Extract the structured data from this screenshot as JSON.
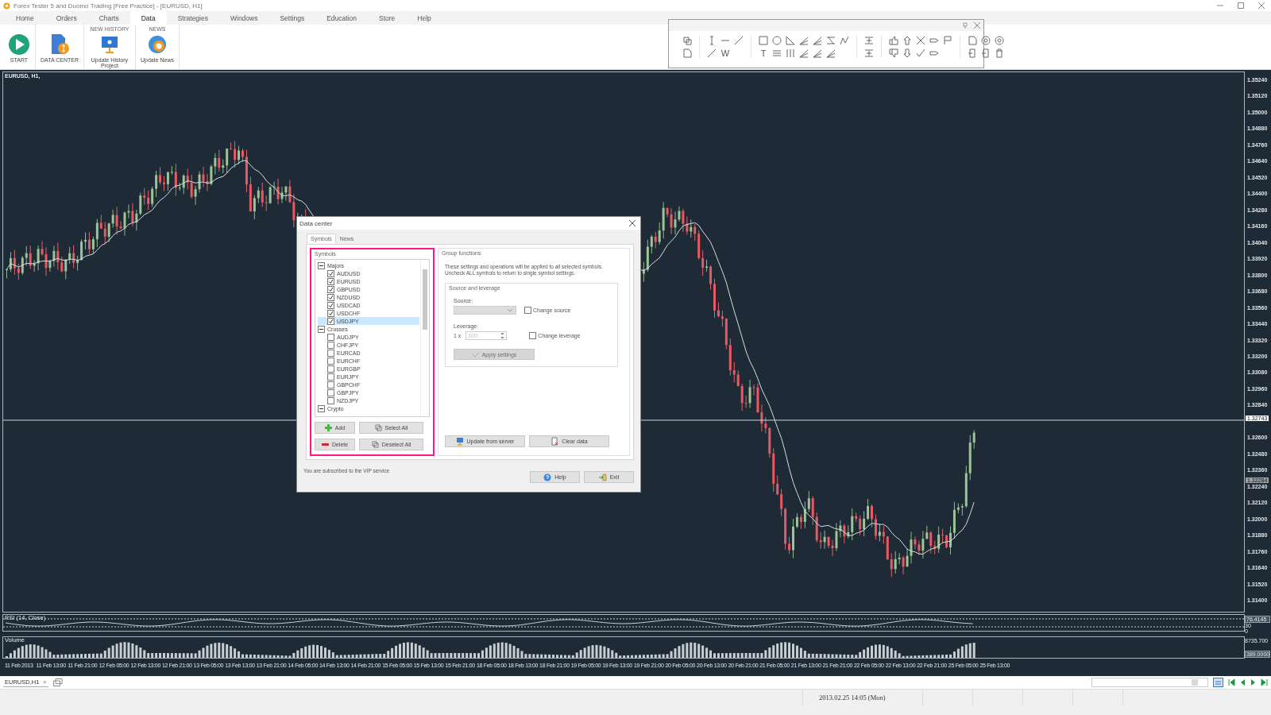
{
  "window": {
    "title": "Forex Tester 5 and Duomo Trading  [Free Practice] - [EURUSD, H1]"
  },
  "menu": [
    {
      "label": "Home",
      "selected": false
    },
    {
      "label": "Orders",
      "selected": false
    },
    {
      "label": "Charts",
      "selected": false
    },
    {
      "label": "Data",
      "selected": true
    },
    {
      "label": "Strategies",
      "selected": false
    },
    {
      "label": "Windows",
      "selected": false
    },
    {
      "label": "Settings",
      "selected": false
    },
    {
      "label": "Education",
      "selected": false
    },
    {
      "label": "Store",
      "selected": false
    },
    {
      "label": "Help",
      "selected": false
    }
  ],
  "ribbon": [
    {
      "kind": "start",
      "label": "START"
    },
    {
      "kind": "data",
      "label": "DATA CENTER"
    },
    {
      "kind": "history",
      "header": "NEW HISTORY",
      "label": "Update History Project"
    },
    {
      "kind": "news",
      "header": "NEWS",
      "label": "Update News"
    }
  ],
  "drawing_toolbar": {
    "text_tools": [
      "W",
      "T"
    ]
  },
  "chart": {
    "title": "EURUSD, H1,",
    "price_ticks": [
      "1.35240",
      "1.35120",
      "1.35000",
      "1.34880",
      "1.34760",
      "1.34640",
      "1.34520",
      "1.34400",
      "1.34280",
      "1.34160",
      "1.34040",
      "1.33920",
      "1.33800",
      "1.33680",
      "1.33560",
      "1.33440",
      "1.33320",
      "1.33200",
      "1.33080",
      "1.32960",
      "1.32840",
      "1.32600",
      "1.32480",
      "1.32360",
      "1.32240",
      "1.32120",
      "1.32000",
      "1.31880",
      "1.31760",
      "1.31640",
      "1.31520",
      "1.31400"
    ],
    "price_tags": [
      {
        "kind": "current",
        "value": "1.32743"
      },
      {
        "kind": "marker",
        "value": "1.32284"
      }
    ],
    "time_ticks": [
      "11 Feb 2013",
      "11 Feb 13:00",
      "11 Feb 21:00",
      "12 Feb 05:00",
      "12 Feb 13:00",
      "12 Feb 21:00",
      "13 Feb 05:00",
      "13 Feb 13:00",
      "13 Feb 21:00",
      "14 Feb 05:00",
      "14 Feb 13:00",
      "14 Feb 21:00",
      "15 Feb 05:00",
      "15 Feb 13:00",
      "15 Feb 21:00",
      "18 Feb 05:00",
      "18 Feb 13:00",
      "18 Feb 21:00",
      "19 Feb 05:00",
      "19 Feb 13:00",
      "19 Feb 21:00",
      "20 Feb 05:00",
      "20 Feb 13:00",
      "20 Feb 21:00",
      "21 Feb 05:00",
      "21 Feb 13:00",
      "21 Feb 21:00",
      "22 Feb 05:00",
      "22 Feb 13:00",
      "22 Feb 21:00",
      "25 Feb 05:00",
      "25 Feb 13:00"
    ]
  },
  "rsi": {
    "title": "RSI (14, Close)",
    "labels": [
      "76.4145",
      "30",
      "0"
    ]
  },
  "volume": {
    "title": "Volume",
    "labels": [
      "8735.700",
      "389.0000"
    ]
  },
  "chart_tabs": [
    {
      "label": "EURUSD,H1",
      "close": "×",
      "selected": true
    }
  ],
  "status_bar": {
    "datetime": "2013.02.25 14:05 (Mon)"
  },
  "dialog": {
    "title": "Data center",
    "tabs": [
      {
        "label": "Symbols",
        "selected": true
      },
      {
        "label": "News",
        "selected": false
      }
    ],
    "symbols": {
      "title": "Symbols",
      "tree": [
        {
          "label": "Majors",
          "expanded": true,
          "children": [
            {
              "label": "AUDUSD",
              "checked": true,
              "selected": false
            },
            {
              "label": "EURUSD",
              "checked": true,
              "selected": false
            },
            {
              "label": "GBPUSD",
              "checked": true,
              "selected": false
            },
            {
              "label": "NZDUSD",
              "checked": true,
              "selected": false
            },
            {
              "label": "USDCAD",
              "checked": true,
              "selected": false
            },
            {
              "label": "USDCHF",
              "checked": true,
              "selected": false
            },
            {
              "label": "USDJPY",
              "checked": true,
              "selected": true
            }
          ]
        },
        {
          "label": "Crosses",
          "expanded": true,
          "children": [
            {
              "label": "AUDJPY",
              "checked": false,
              "selected": false
            },
            {
              "label": "CHFJPY",
              "checked": false,
              "selected": false
            },
            {
              "label": "EURCAD",
              "checked": false,
              "selected": false
            },
            {
              "label": "EURCHF",
              "checked": false,
              "selected": false
            },
            {
              "label": "EURGBP",
              "checked": false,
              "selected": false
            },
            {
              "label": "EURJPY",
              "checked": false,
              "selected": false
            },
            {
              "label": "GBPCHF",
              "checked": false,
              "selected": false
            },
            {
              "label": "GBPJPY",
              "checked": false,
              "selected": false
            },
            {
              "label": "NZDJPY",
              "checked": false,
              "selected": false
            }
          ]
        },
        {
          "label": "Crypto",
          "expanded": true
        }
      ],
      "buttons": [
        {
          "kind": "add",
          "label": "Add"
        },
        {
          "kind": "select",
          "label": "Select All"
        },
        {
          "kind": "delete",
          "label": "Delete"
        },
        {
          "kind": "deselect",
          "label": "Deselect All"
        }
      ]
    },
    "group": {
      "title": "Group functions",
      "note": "These settings and operations will be applied to all selected symbols. Uncheck ALL symbols to return to single symbol settings.",
      "source_leverage": {
        "title": "Source and leverage",
        "source_label": "Source:",
        "change_source": {
          "label": "Change source",
          "checked": false
        },
        "leverage_label": "Leverage:",
        "leverage_prefix": "1 x",
        "leverage_value": "100",
        "change_leverage": {
          "label": "Change leverage",
          "checked": false
        },
        "apply": {
          "label": "Apply settings",
          "disabled": true
        }
      },
      "buttons": [
        {
          "kind": "update",
          "label": "Update from server"
        },
        {
          "kind": "clear",
          "label": "Clear data"
        }
      ]
    },
    "footer": "You are subscribed to the VIP service",
    "buttons": [
      {
        "kind": "help",
        "label": "Help"
      },
      {
        "kind": "exit",
        "label": "Exit"
      }
    ]
  }
}
